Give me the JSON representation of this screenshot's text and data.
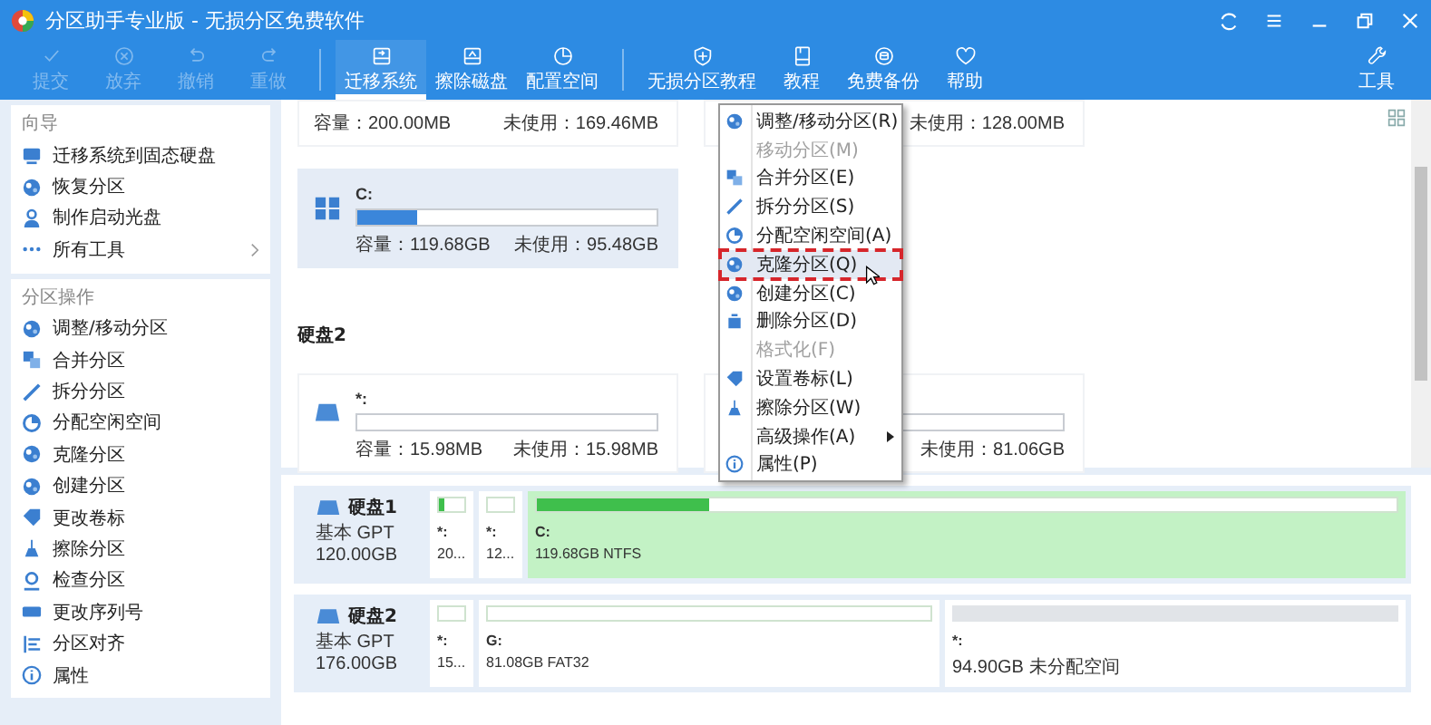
{
  "window": {
    "title": "分区助手专业版 - 无损分区免费软件"
  },
  "toolbar": {
    "items": [
      {
        "kind": "button",
        "label": "提交",
        "disabled": true,
        "selected": false
      },
      {
        "kind": "button",
        "label": "放弃",
        "disabled": true,
        "selected": false
      },
      {
        "kind": "button",
        "label": "撤销",
        "disabled": true,
        "selected": false
      },
      {
        "kind": "button",
        "label": "重做",
        "disabled": true,
        "selected": false
      },
      {
        "kind": "separator"
      },
      {
        "kind": "button",
        "label": "迁移系统",
        "disabled": false,
        "selected": true
      },
      {
        "kind": "button",
        "label": "擦除磁盘",
        "disabled": false,
        "selected": false
      },
      {
        "kind": "button",
        "label": "配置空间",
        "disabled": false,
        "selected": false
      },
      {
        "kind": "separator"
      },
      {
        "kind": "button",
        "label": "无损分区教程",
        "disabled": false,
        "selected": false
      },
      {
        "kind": "button",
        "label": "教程",
        "disabled": false,
        "selected": false
      },
      {
        "kind": "button",
        "label": "免费备份",
        "disabled": false,
        "selected": false
      },
      {
        "kind": "button",
        "label": "帮助",
        "disabled": false,
        "selected": false
      }
    ],
    "tools": {
      "label": "工具"
    }
  },
  "sidebar": {
    "sections": [
      {
        "title": "向导",
        "items": [
          {
            "kind": "action",
            "label": "迁移系统到固态硬盘"
          },
          {
            "kind": "action",
            "label": "恢复分区"
          },
          {
            "kind": "action",
            "label": "制作启动光盘"
          },
          {
            "kind": "more",
            "label": "所有工具"
          }
        ]
      },
      {
        "title": "分区操作",
        "items": [
          {
            "kind": "action",
            "label": "调整/移动分区"
          },
          {
            "kind": "action",
            "label": "合并分区"
          },
          {
            "kind": "action",
            "label": "拆分分区"
          },
          {
            "kind": "action",
            "label": "分配空闲空间"
          },
          {
            "kind": "action",
            "label": "克隆分区"
          },
          {
            "kind": "action",
            "label": "创建分区"
          },
          {
            "kind": "action",
            "label": "更改卷标"
          },
          {
            "kind": "action",
            "label": "擦除分区"
          },
          {
            "kind": "action",
            "label": "检查分区"
          },
          {
            "kind": "action",
            "label": "更改序列号"
          },
          {
            "kind": "action",
            "label": "分区对齐"
          },
          {
            "kind": "action",
            "label": "属性"
          }
        ]
      }
    ]
  },
  "partition_view": {
    "groups": [
      {
        "rows": [
          [
            {
              "kind": "clipped",
              "capacity": "容量：200.00MB",
              "unused": "未使用：169.46MB",
              "selected": false
            },
            {
              "kind": "clipped",
              "unused": "未使用：128.00MB",
              "selected": false
            }
          ],
          [
            {
              "kind": "system",
              "name": "C:",
              "level": 0.2,
              "capacity": "容量：119.68GB",
              "unused": "未使用：95.48GB",
              "selected": true
            }
          ]
        ]
      },
      {
        "header": "硬盘2",
        "rows": [
          [
            {
              "kind": "data",
              "name": "*:",
              "capacity": "容量：15.98MB",
              "unused": "未使用：15.98MB",
              "selected": false
            },
            {
              "kind": "data",
              "unused": "未使用：81.06GB",
              "selected": false
            }
          ]
        ]
      }
    ]
  },
  "disk_map": {
    "disks": [
      {
        "name": "硬盘1",
        "type": "基本 GPT",
        "size": "120.00GB",
        "partitions": [
          {
            "kind": "small",
            "name": "*:",
            "info": "20...",
            "level": 0.2,
            "selected": false
          },
          {
            "kind": "small",
            "name": "*:",
            "info": "12...",
            "selected": false
          },
          {
            "kind": "large",
            "name": "C:",
            "info": "119.68GB NTFS",
            "level": 0.2,
            "selected": true
          }
        ]
      },
      {
        "name": "硬盘2",
        "type": "基本 GPT",
        "size": "176.00GB",
        "partitions": [
          {
            "kind": "small",
            "name": "*:",
            "info": "15...",
            "selected": false
          },
          {
            "kind": "large",
            "name": "G:",
            "info": "81.08GB FAT32",
            "selected": false
          },
          {
            "kind": "unallocated",
            "name": "*:",
            "info": "94.90GB 未分配空间",
            "selected": false
          }
        ]
      }
    ]
  },
  "context_menu": {
    "items": [
      {
        "kind": "item",
        "label": "调整/移动分区(R)",
        "disabled": false,
        "selected": false
      },
      {
        "kind": "item",
        "label": "移动分区(M)",
        "disabled": true,
        "selected": false
      },
      {
        "kind": "item",
        "label": "合并分区(E)",
        "disabled": false,
        "selected": false
      },
      {
        "kind": "item",
        "label": "拆分分区(S)",
        "disabled": false,
        "selected": false
      },
      {
        "kind": "item",
        "label": "分配空闲空间(A)",
        "disabled": false,
        "selected": false
      },
      {
        "kind": "item",
        "label": "克隆分区(Q)",
        "disabled": false,
        "selected": true
      },
      {
        "kind": "item",
        "label": "创建分区(C)",
        "disabled": false,
        "selected": false
      },
      {
        "kind": "item",
        "label": "删除分区(D)",
        "disabled": false,
        "selected": false
      },
      {
        "kind": "item",
        "label": "格式化(F)",
        "disabled": true,
        "selected": false
      },
      {
        "kind": "item",
        "label": "设置卷标(L)",
        "disabled": false,
        "selected": false
      },
      {
        "kind": "item",
        "label": "擦除分区(W)",
        "disabled": false,
        "selected": false
      },
      {
        "kind": "submenu",
        "label": "高级操作(A)",
        "disabled": false,
        "selected": false
      },
      {
        "kind": "item",
        "label": "属性(P)",
        "disabled": false,
        "selected": false
      }
    ]
  }
}
